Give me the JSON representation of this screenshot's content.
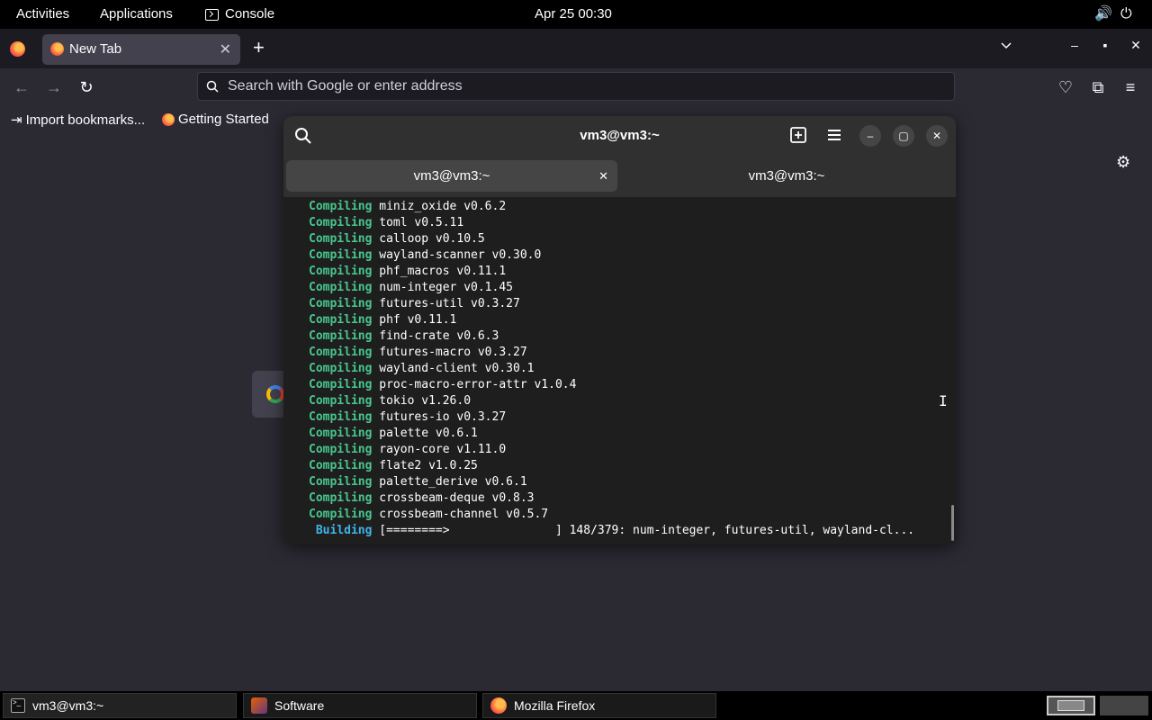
{
  "topbar": {
    "activities": "Activities",
    "applications": "Applications",
    "console": "Console",
    "clock": "Apr 25  00:30",
    "volume_icon": "volume-icon",
    "power_icon": "power-icon"
  },
  "firefox": {
    "tab_title": "New Tab",
    "url_placeholder": "Search with Google or enter address",
    "bookmarks": [
      "Import bookmarks...",
      "Getting Started"
    ]
  },
  "console": {
    "window_title": "vm3@vm3:~",
    "tabs": [
      {
        "label": "vm3@vm3:~",
        "active": true
      },
      {
        "label": "vm3@vm3:~",
        "active": false
      }
    ],
    "lines": [
      {
        "kw": "Compiling",
        "text": "miniz_oxide v0.6.2"
      },
      {
        "kw": "Compiling",
        "text": "toml v0.5.11"
      },
      {
        "kw": "Compiling",
        "text": "calloop v0.10.5"
      },
      {
        "kw": "Compiling",
        "text": "wayland-scanner v0.30.0"
      },
      {
        "kw": "Compiling",
        "text": "phf_macros v0.11.1"
      },
      {
        "kw": "Compiling",
        "text": "num-integer v0.1.45"
      },
      {
        "kw": "Compiling",
        "text": "futures-util v0.3.27"
      },
      {
        "kw": "Compiling",
        "text": "phf v0.11.1"
      },
      {
        "kw": "Compiling",
        "text": "find-crate v0.6.3"
      },
      {
        "kw": "Compiling",
        "text": "futures-macro v0.3.27"
      },
      {
        "kw": "Compiling",
        "text": "wayland-client v0.30.1"
      },
      {
        "kw": "Compiling",
        "text": "proc-macro-error-attr v1.0.4"
      },
      {
        "kw": "Compiling",
        "text": "tokio v1.26.0"
      },
      {
        "kw": "Compiling",
        "text": "futures-io v0.3.27"
      },
      {
        "kw": "Compiling",
        "text": "palette v0.6.1"
      },
      {
        "kw": "Compiling",
        "text": "rayon-core v1.11.0"
      },
      {
        "kw": "Compiling",
        "text": "flate2 v1.0.25"
      },
      {
        "kw": "Compiling",
        "text": "palette_derive v0.6.1"
      },
      {
        "kw": "Compiling",
        "text": "crossbeam-deque v0.8.3"
      },
      {
        "kw": "Compiling",
        "text": "crossbeam-channel v0.5.7"
      }
    ],
    "building_kw": "Building",
    "building_text": "[========>               ] 148/379: num-integer, futures-util, wayland-cl..."
  },
  "taskbar": {
    "items": [
      "vm3@vm3:~",
      "Software",
      "Mozilla Firefox"
    ]
  }
}
